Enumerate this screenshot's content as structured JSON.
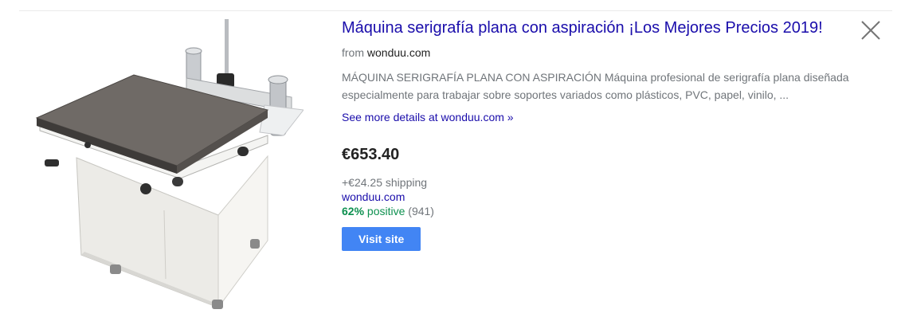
{
  "product": {
    "title": "Máquina serigrafía plana con aspiración ¡Los Mejores Precios 2019!",
    "source_prefix": "from",
    "source_domain": "wonduu.com",
    "description": "MÁQUINA SERIGRAFÍA PLANA CON ASPIRACIÓN Máquina profesional de serigrafía plana diseñada especialmente para trabajar sobre soportes variados como plásticos, PVC, papel, vinilo, ...",
    "more_details": "See more details at wonduu.com »",
    "price": "€653.40",
    "shipping": "+€24.25 shipping",
    "seller": "wonduu.com",
    "rating_percent": "62%",
    "rating_word": "positive",
    "rating_count": "(941)",
    "visit_label": "Visit site",
    "image_icon": "screen-printing-machine-photo"
  },
  "colors": {
    "link": "#1a0dab",
    "button": "#4285f4",
    "positive": "#0d904f",
    "secondary_text": "#70757a"
  },
  "icons": {
    "close": "close-icon"
  }
}
